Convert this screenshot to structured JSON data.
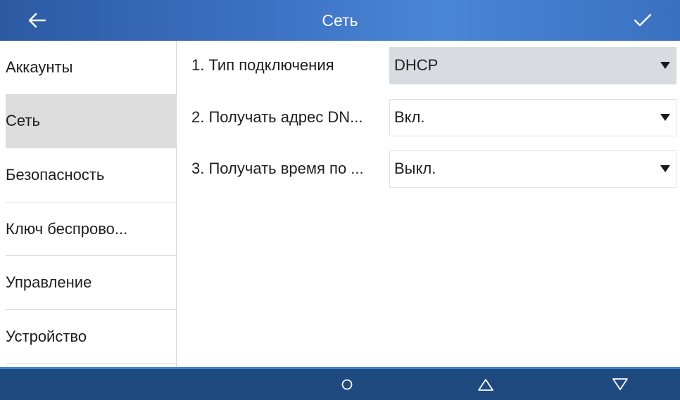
{
  "header": {
    "title": "Сеть",
    "back_icon": "arrow-left-icon",
    "confirm_icon": "checkmark-icon",
    "accent": "#3d72c4"
  },
  "sidebar": {
    "items": [
      {
        "label": "Аккаунты",
        "active": false
      },
      {
        "label": "Сеть",
        "active": true
      },
      {
        "label": "Безопасность",
        "active": false
      },
      {
        "label": "Ключ беспрово...",
        "active": false
      },
      {
        "label": "Управление",
        "active": false
      },
      {
        "label": "Устройство",
        "active": false
      }
    ]
  },
  "settings": {
    "rows": [
      {
        "label": "1.  Тип подключения",
        "value": "DHCP",
        "focused": true
      },
      {
        "label": "2. Получать адрес DN...",
        "value": "Вкл.",
        "focused": false
      },
      {
        "label": "3. Получать время по ...",
        "value": "Выкл.",
        "focused": false
      }
    ]
  },
  "navbar": {
    "home_icon": "circle-home-icon",
    "up_icon": "triangle-up-icon",
    "down_icon": "triangle-down-icon",
    "color": "#1f4a80"
  }
}
